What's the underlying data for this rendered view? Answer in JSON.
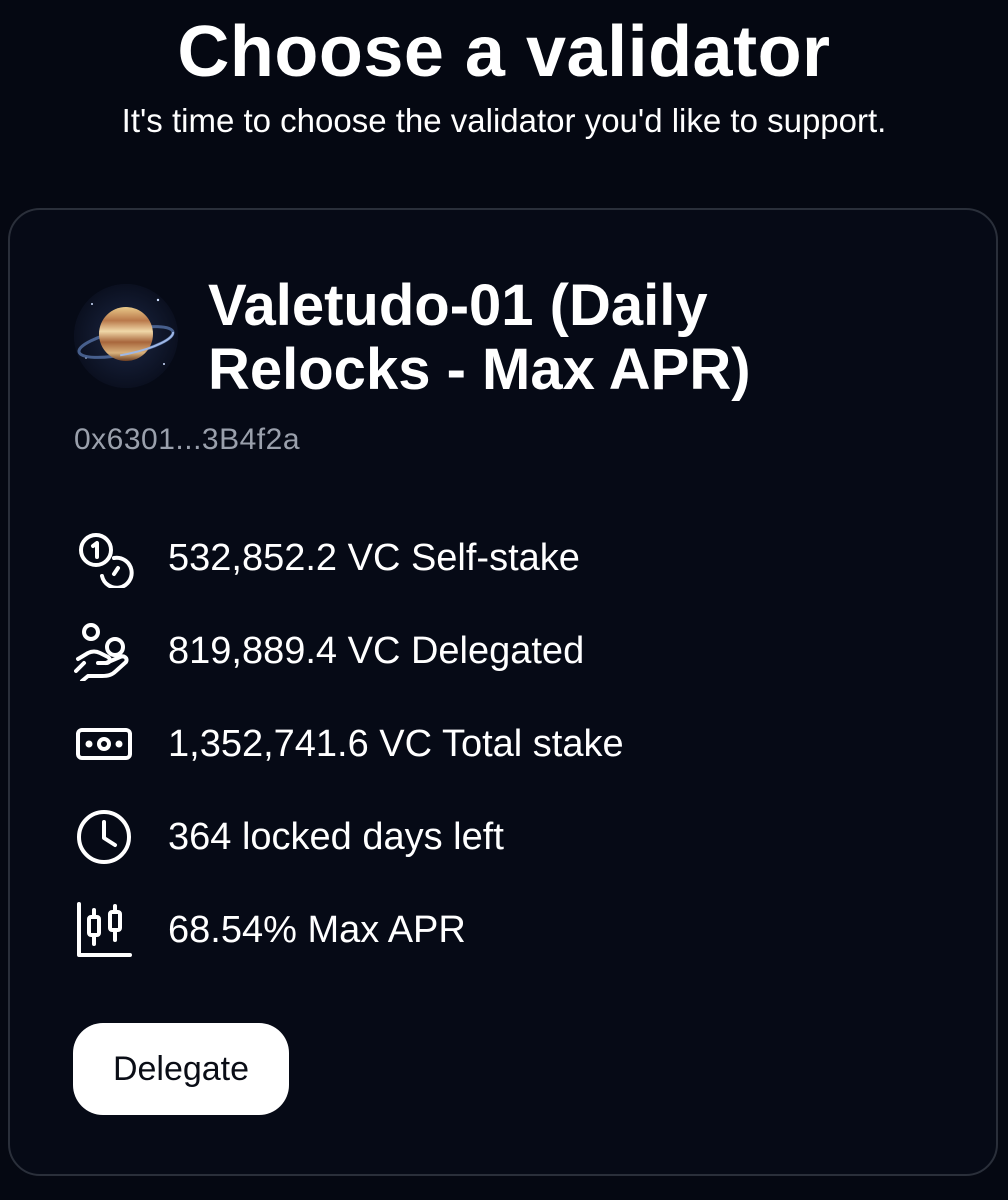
{
  "header": {
    "title": "Choose a validator",
    "subtitle": "It's time to choose the validator you'd like to support."
  },
  "validator": {
    "avatar_icon": "planet-avatar-icon",
    "name": "Valetudo-01 (Daily Relocks - Max APR)",
    "address": "0x6301...3B4f2a",
    "stats": [
      {
        "icon": "coins-icon",
        "text": "532,852.2 VC Self-stake"
      },
      {
        "icon": "hand-coins-icon",
        "text": "819,889.4 VC Delegated"
      },
      {
        "icon": "banknote-icon",
        "text": "1,352,741.6 VC Total stake"
      },
      {
        "icon": "clock-icon",
        "text": "364 locked days left"
      },
      {
        "icon": "candlestick-chart-icon",
        "text": "68.54% Max APR"
      }
    ]
  },
  "actions": {
    "delegate_label": "Delegate"
  },
  "colors": {
    "background": "#050812",
    "card_border": "#2a2f3a",
    "muted_text": "#9aa0ac",
    "button_bg": "#ffffff",
    "button_text": "#0a0d16"
  }
}
